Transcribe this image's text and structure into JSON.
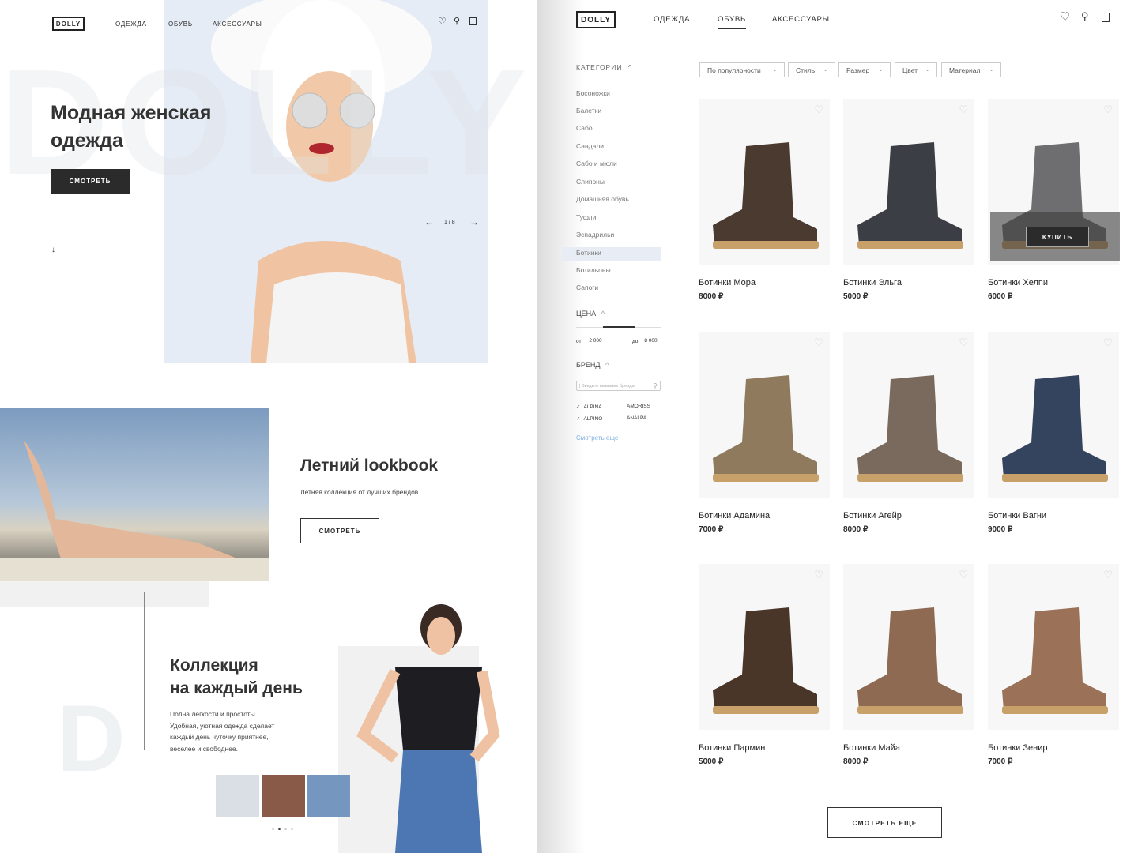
{
  "left": {
    "header": {
      "logo": "DOLLY",
      "nav": [
        "ОДЕЖДА",
        "ОБУВЬ",
        "АКСЕССУАРЫ"
      ]
    },
    "hero": {
      "watermark": "DOLLY",
      "title_line1": "Модная женская",
      "title_line2": "одежда",
      "button": "СМОТРЕТЬ",
      "slide": "1 / 8",
      "bg": "#e6ecf6"
    },
    "lookbook": {
      "title": "Летний lookbook",
      "subtitle": "Летняя коллекция от лучших брендов",
      "button": "СМОТРЕТЬ"
    },
    "collection": {
      "watermark": "D",
      "title_line1": "Коллекция",
      "title_line2": "на каждый день",
      "text": [
        "Полна легкости и простоты.",
        "Удобная, уютная одежда сделает",
        "каждый день чуточку приятнее,",
        "веселее и свободнее."
      ],
      "dots_total": 4,
      "dot_active": 2
    }
  },
  "right": {
    "header": {
      "logo": "DOLLY",
      "nav": [
        "ОДЕЖДА",
        "ОБУВЬ",
        "АКСЕССУАРЫ"
      ],
      "active": "ОБУВЬ"
    },
    "sidebar": {
      "categories_label": "КАТЕГОРИИ",
      "categories": [
        "Босоножки",
        "Балетки",
        "Сабо",
        "Сандали",
        "Сабо и мюли",
        "Слипоны",
        "Домашняя обувь",
        "Туфли",
        "Эспадрильи",
        "Ботинки",
        "Ботильоны",
        "Сапоги"
      ],
      "active_category": "Ботинки",
      "price_label": "ЦЕНА",
      "from_label": "от",
      "from": "2 000",
      "to_label": "до",
      "to": "8 000",
      "brand_label": "БРЕНД",
      "brand_placeholder": "Введите название бренда",
      "brands": [
        {
          "name": "ALPINA",
          "checked": true
        },
        {
          "name": "AMORISS",
          "checked": false
        },
        {
          "name": "ALPINO",
          "checked": true
        },
        {
          "name": "ANALPA",
          "checked": false
        }
      ],
      "more": "Смотреть еще"
    },
    "filters": [
      "По популярности",
      "Стиль",
      "Размер",
      "Цвет",
      "Материал"
    ],
    "products": [
      {
        "name": "Ботинки Мора",
        "price": "8000 ₽",
        "color": "#4a3a30"
      },
      {
        "name": "Ботинки Эльга",
        "price": "5000 ₽",
        "color": "#3b3e44"
      },
      {
        "name": "Ботинки Хелпи",
        "price": "6000 ₽",
        "color": "#6e6e70",
        "hover_button": "КУПИТЬ"
      },
      {
        "name": "Ботинки Адамина",
        "price": "7000 ₽",
        "color": "#8f7a5e"
      },
      {
        "name": "Ботинки Агейр",
        "price": "8000 ₽",
        "color": "#7a6a5e"
      },
      {
        "name": "Ботинки Вагни",
        "price": "9000 ₽",
        "color": "#34445e"
      },
      {
        "name": "Ботинки Пармин",
        "price": "5000 ₽",
        "color": "#4a3628"
      },
      {
        "name": "Ботинки Майа",
        "price": "8000 ₽",
        "color": "#8e6a52"
      },
      {
        "name": "Ботинки Зенир",
        "price": "7000 ₽",
        "color": "#9b7258"
      }
    ],
    "load_more": "СМОТРЕТЬ ЕЩЕ"
  }
}
